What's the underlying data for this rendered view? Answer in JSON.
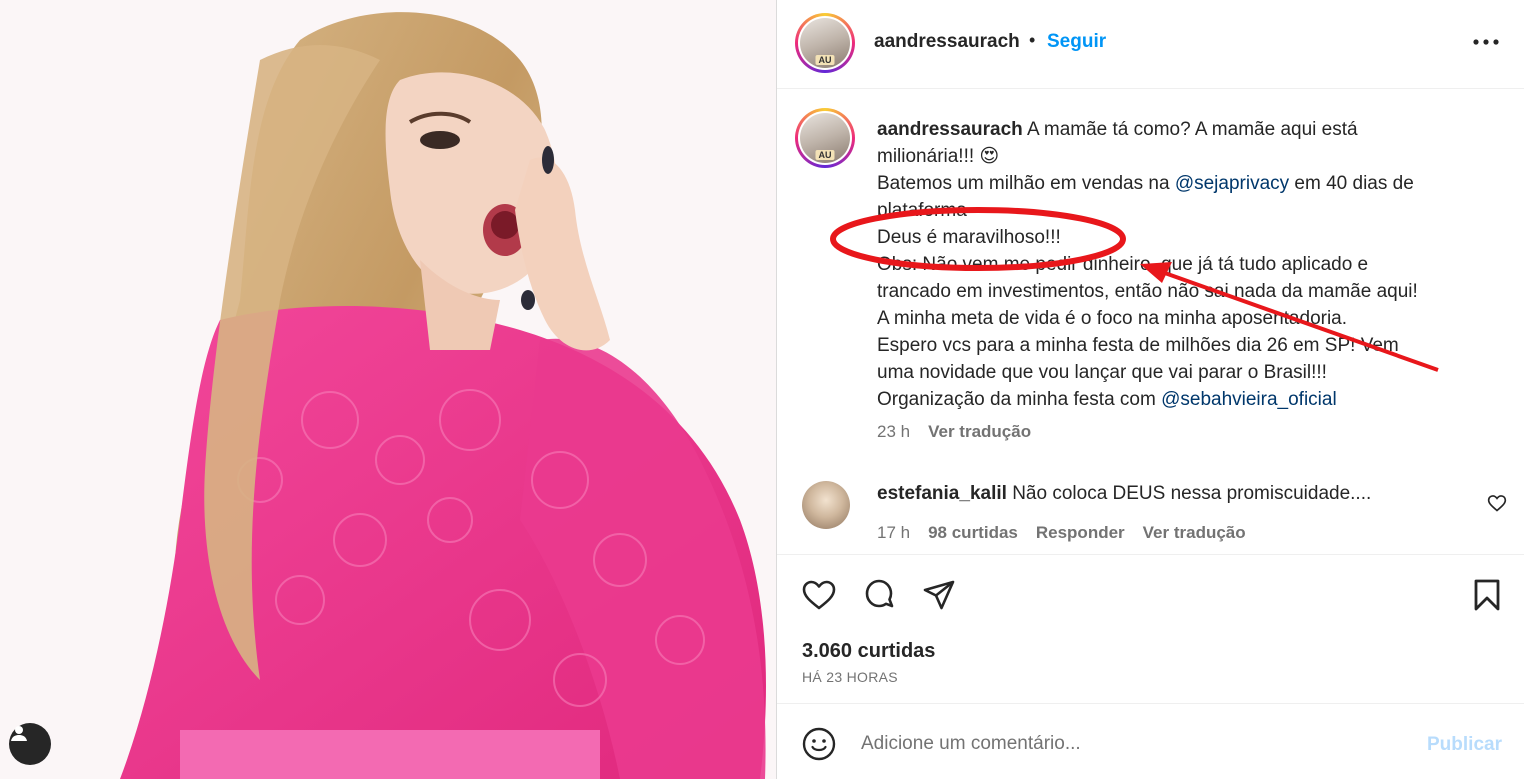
{
  "post": {
    "author": "aandressaurach",
    "follow_label": "Seguir",
    "dot": "•",
    "avatar_badge": "AU"
  },
  "caption": {
    "username": "aandressaurach",
    "line1": "A mamãe tá como? A mamãe aqui está",
    "line2": "milionária!!! 😍",
    "line3_pre": "Batemos um milhão em vendas na ",
    "line3_mention": "@sejaprivacy",
    "line3_post": " em 40 dias de",
    "line4": "plataforma",
    "line5": "Deus é maravilhoso!!!",
    "line6": "Obs: Não vem me pedir dinheiro, que já tá tudo aplicado e",
    "line7": "trancado em investimentos, então não sai nada da mamãe aqui!",
    "line8": "A minha meta de vida é o foco na minha aposentadoria.",
    "line9": "Espero vcs para a minha festa de milhões dia 26 em SP! Vem",
    "line10": "uma novidade que vou lançar que vai parar o Brasil!!!",
    "line11_pre": "Organização da minha festa com ",
    "line11_mention": "@sebahvieira_oficial",
    "time": "23 h",
    "translate": "Ver tradução"
  },
  "comment": {
    "username": "estefania_kalil",
    "text": "Não coloca DEUS nessa promiscuidade....",
    "time": "17 h",
    "likes": "98 curtidas",
    "reply": "Responder",
    "translate": "Ver tradução"
  },
  "stats": {
    "likes": "3.060 curtidas",
    "time_ago": "HÁ 23 HORAS"
  },
  "add_comment": {
    "placeholder": "Adicione um comentário...",
    "post_label": "Publicar"
  },
  "colors": {
    "accent": "#0095f6",
    "mention": "#00376b",
    "muted": "#737373",
    "annotation": "#e8171b",
    "photo_top": "#f03a8f"
  }
}
